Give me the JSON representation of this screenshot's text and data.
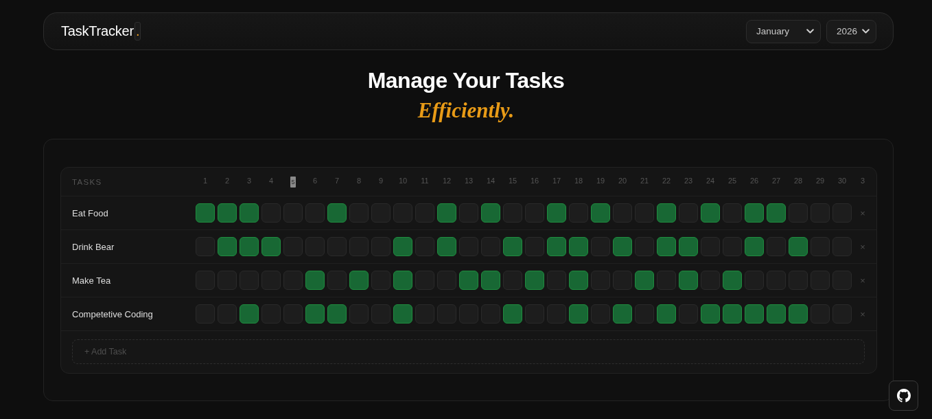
{
  "header": {
    "logo": {
      "name": "TaskTracker",
      "accent": "."
    },
    "month_select": {
      "value": "January"
    },
    "year_select": {
      "value": "2026"
    }
  },
  "hero": {
    "title": "Manage Your Tasks",
    "subtitle": "Efficiently."
  },
  "tracker": {
    "tasks_heading": "TASKS",
    "days": [
      {
        "label": "1",
        "today": false
      },
      {
        "label": "2",
        "today": false
      },
      {
        "label": "3",
        "today": false
      },
      {
        "label": "4",
        "today": false
      },
      {
        "label": "5",
        "today": true
      },
      {
        "label": "6",
        "today": false
      },
      {
        "label": "7",
        "today": false
      },
      {
        "label": "8",
        "today": false
      },
      {
        "label": "9",
        "today": false
      },
      {
        "label": "10",
        "today": false
      },
      {
        "label": "11",
        "today": false
      },
      {
        "label": "12",
        "today": false
      },
      {
        "label": "13",
        "today": false
      },
      {
        "label": "14",
        "today": false
      },
      {
        "label": "15",
        "today": false
      },
      {
        "label": "16",
        "today": false
      },
      {
        "label": "17",
        "today": false
      },
      {
        "label": "18",
        "today": false
      },
      {
        "label": "19",
        "today": false
      },
      {
        "label": "20",
        "today": false
      },
      {
        "label": "21",
        "today": false
      },
      {
        "label": "22",
        "today": false
      },
      {
        "label": "23",
        "today": false
      },
      {
        "label": "24",
        "today": false
      },
      {
        "label": "25",
        "today": false
      },
      {
        "label": "26",
        "today": false
      },
      {
        "label": "27",
        "today": false
      },
      {
        "label": "28",
        "today": false
      },
      {
        "label": "29",
        "today": false
      },
      {
        "label": "30",
        "today": false
      },
      {
        "label": "3",
        "today": false
      }
    ],
    "tasks": [
      {
        "name": "Eat Food",
        "delete": "×",
        "done": [
          true,
          true,
          true,
          false,
          false,
          false,
          true,
          false,
          false,
          false,
          false,
          true,
          false,
          true,
          false,
          false,
          true,
          false,
          true,
          false,
          false,
          true,
          false,
          true,
          false,
          true,
          true,
          false,
          false,
          false
        ]
      },
      {
        "name": "Drink Bear",
        "delete": "×",
        "done": [
          false,
          true,
          true,
          true,
          false,
          false,
          false,
          false,
          false,
          true,
          false,
          true,
          false,
          false,
          true,
          false,
          true,
          true,
          false,
          true,
          false,
          true,
          true,
          false,
          false,
          true,
          false,
          true,
          false,
          false
        ]
      },
      {
        "name": "Make Tea",
        "delete": "×",
        "done": [
          false,
          false,
          false,
          false,
          false,
          true,
          false,
          true,
          false,
          true,
          false,
          false,
          true,
          true,
          false,
          true,
          false,
          true,
          false,
          false,
          true,
          false,
          true,
          false,
          true,
          false,
          false,
          false,
          false,
          false
        ]
      },
      {
        "name": "Competetive Coding",
        "delete": "×",
        "done": [
          false,
          false,
          true,
          false,
          false,
          true,
          true,
          false,
          false,
          true,
          false,
          false,
          false,
          false,
          true,
          false,
          false,
          true,
          false,
          true,
          false,
          true,
          false,
          true,
          true,
          true,
          true,
          true,
          false,
          false
        ]
      }
    ],
    "add_task": {
      "placeholder": "+ Add Task"
    }
  }
}
